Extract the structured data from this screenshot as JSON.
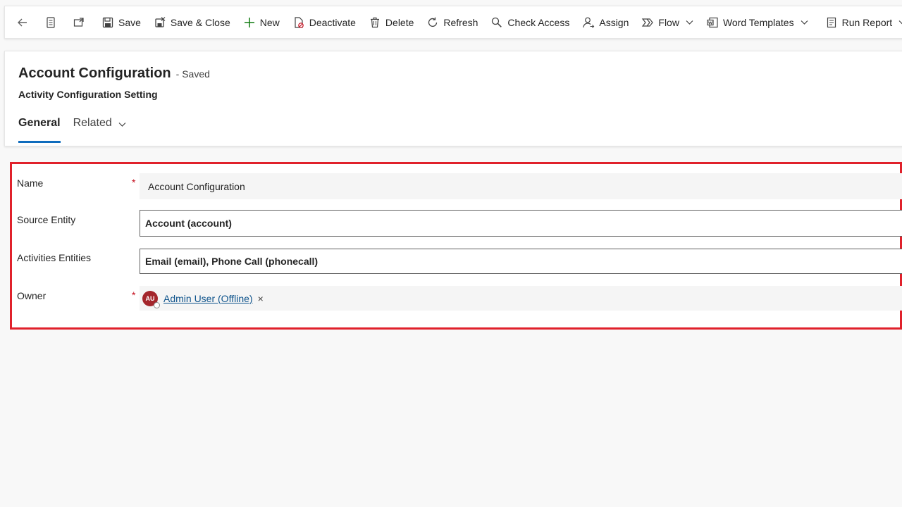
{
  "toolbar": {
    "save": "Save",
    "save_close": "Save & Close",
    "new": "New",
    "deactivate": "Deactivate",
    "delete": "Delete",
    "refresh": "Refresh",
    "check_access": "Check Access",
    "assign": "Assign",
    "flow": "Flow",
    "word_templates": "Word Templates",
    "run_report": "Run Report"
  },
  "header": {
    "title": "Account Configuration",
    "status": "- Saved",
    "entity_type": "Activity Configuration Setting"
  },
  "tabs": [
    {
      "label": "General"
    },
    {
      "label": "Related"
    }
  ],
  "form": {
    "name": {
      "label": "Name",
      "required_mark": "*",
      "value": "Account Configuration"
    },
    "source_entity": {
      "label": "Source Entity",
      "value": "Account (account)"
    },
    "activities_entities": {
      "label": "Activities Entities",
      "value": "Email (email), Phone Call (phonecall)"
    },
    "owner": {
      "label": "Owner",
      "required_mark": "*",
      "initials": "AU",
      "value": "Admin User (Offline)",
      "remove": "×"
    }
  },
  "colors": {
    "accent": "#0f6cbd",
    "highlight_border": "#e0212b",
    "required": "#c50f1f",
    "avatar": "#a4262c"
  }
}
